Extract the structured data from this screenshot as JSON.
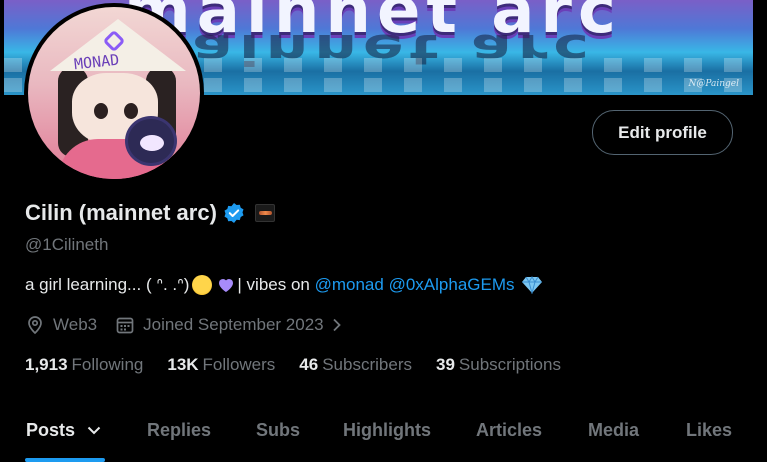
{
  "banner": {
    "text": "mainnet arc",
    "signature": "N@Paingel"
  },
  "avatar": {
    "hat_text": "MONAD"
  },
  "profile": {
    "edit_label": "Edit profile",
    "name": "Cilin (mainnet arc)",
    "handle": "@1Cilineth",
    "bio_prefix": "a girl learning...  ( ᐢ. .ᐢ)",
    "bio_mid": "| vibes on ",
    "mention1": "@monad",
    "mention2": "@0xAlphaGEMs",
    "location": "Web3",
    "joined": "Joined September 2023"
  },
  "stats": [
    {
      "num": "1,913",
      "label": "Following"
    },
    {
      "num": "13K",
      "label": "Followers"
    },
    {
      "num": "46",
      "label": "Subscribers"
    },
    {
      "num": "39",
      "label": "Subscriptions"
    }
  ],
  "tabs": [
    "Posts",
    "Replies",
    "Subs",
    "Highlights",
    "Articles",
    "Media",
    "Likes"
  ],
  "colors": {
    "accent": "#1d9bf0",
    "muted": "#71767b",
    "text": "#e7e9ea",
    "heart": "#a78bfa"
  },
  "icons": [
    "verified-badge-icon",
    "affiliation-badge-icon",
    "location-icon",
    "calendar-icon",
    "chevron-right-icon",
    "chevron-down-icon",
    "heart-icon",
    "gem-icon",
    "face-emoji-icon"
  ]
}
